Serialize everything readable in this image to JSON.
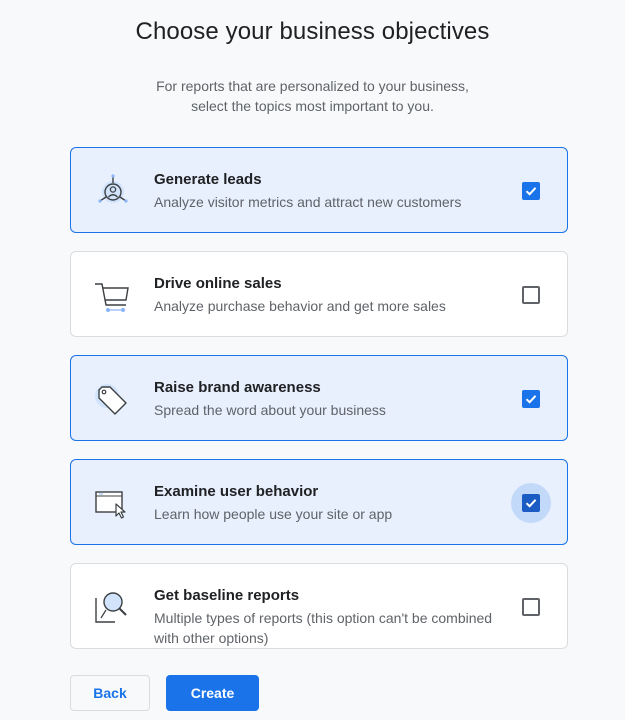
{
  "header": {
    "title": "Choose your business objectives",
    "subtitle_line1": "For reports that are personalized to your business,",
    "subtitle_line2": "select the topics most important to you."
  },
  "objectives": [
    {
      "label": "Generate leads",
      "description": "Analyze visitor metrics and attract new customers",
      "icon": "lead-target-icon",
      "checked": true
    },
    {
      "label": "Drive online sales",
      "description": "Analyze purchase behavior and get more sales",
      "icon": "shopping-cart-icon",
      "checked": false
    },
    {
      "label": "Raise brand awareness",
      "description": "Spread the word about your business",
      "icon": "tag-icon",
      "checked": true
    },
    {
      "label": "Examine user behavior",
      "description": "Learn how people use your site or app",
      "icon": "browser-cursor-icon",
      "checked": true
    },
    {
      "label": "Get baseline reports",
      "description_line1": "Multiple types of reports (this option can't be combined",
      "description_line2": "with other options)",
      "icon": "magnifier-report-icon",
      "checked": false
    }
  ],
  "footer": {
    "back_label": "Back",
    "create_label": "Create"
  },
  "colors": {
    "accent": "#1a73e8",
    "selected_bg": "#e8f0fe",
    "border": "#dadce0",
    "text_primary": "#202124",
    "text_secondary": "#5f6368"
  }
}
